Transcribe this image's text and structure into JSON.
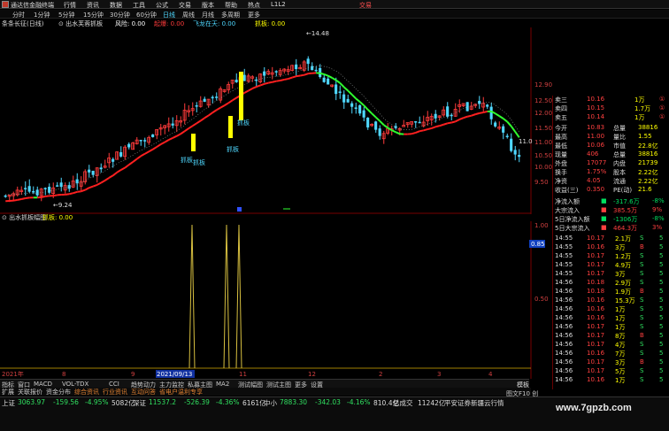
{
  "app": {
    "title": "通达信金融终端",
    "trade": "交易"
  },
  "menu": [
    "行情",
    "资讯",
    "数据",
    "工具",
    "公式",
    "交易",
    "版本",
    "帮助",
    "热点",
    "L1L2"
  ],
  "periods": [
    {
      "label": "分时",
      "active": false
    },
    {
      "label": "1分钟",
      "active": false
    },
    {
      "label": "5分钟",
      "active": false
    },
    {
      "label": "15分钟",
      "active": false
    },
    {
      "label": "30分钟",
      "active": false
    },
    {
      "label": "60分钟",
      "active": false
    },
    {
      "label": "日线",
      "active": true
    },
    {
      "label": "周线",
      "active": false
    },
    {
      "label": "月线",
      "active": false
    },
    {
      "label": "多周期",
      "active": false
    },
    {
      "label": "更多",
      "active": false
    }
  ],
  "main_indicator": {
    "name": "条条长征(日线)",
    "formula": "出水芙蓉抓板",
    "items": [
      {
        "label": "风险:",
        "value": "0.00",
        "color": "#ffffff"
      },
      {
        "label": "起爆:",
        "value": "0.00",
        "color": "#ff3b3b"
      },
      {
        "label": "飞龙在天:",
        "value": "0.00",
        "color": "#4fd8ff"
      },
      {
        "label": "抓板:",
        "value": "0.00",
        "color": "#ffff00"
      }
    ]
  },
  "sub_indicator": {
    "name": "出水抓板幅图",
    "label": "抓板:",
    "value": "0.00"
  },
  "chart_annotations": {
    "high": "14.48",
    "low": "9.24",
    "signals": [
      "抓板",
      "抓板",
      "抓板",
      "抓板"
    ],
    "date_box": "2021/09/13",
    "year_left": "2021年",
    "last_price_tag": "11.0"
  },
  "price_axis": [
    "12.90",
    "12.50",
    "12.00",
    "11.50",
    "11.00",
    "10.50",
    "10.00",
    "9.50"
  ],
  "sub_axis": [
    "1.00",
    "0.85",
    "0.50"
  ],
  "time_axis": [
    "2021年",
    "8",
    "9",
    "2021/09/13",
    "11",
    "12",
    "2",
    "3",
    "4"
  ],
  "quote": {
    "asks": [
      {
        "label": "卖三",
        "price": "10.16",
        "vol": "1万"
      },
      {
        "label": "卖四",
        "price": "10.15",
        "vol": "1.7万"
      },
      {
        "label": "卖五",
        "price": "10.14",
        "vol": "1万"
      }
    ],
    "stats": [
      {
        "l1": "今开",
        "v1": "10.83",
        "l2": "总量",
        "v2": "38816"
      },
      {
        "l1": "最高",
        "v1": "11.00",
        "l2": "量比",
        "v2": "1.55"
      },
      {
        "l1": "最低",
        "v1": "10.06",
        "l2": "市值",
        "v2": "22.8亿"
      },
      {
        "l1": "现量",
        "v1": "406",
        "l2": "总量",
        "v2": "38816"
      },
      {
        "l1": "外盘",
        "v1": "17077",
        "l2": "内盘",
        "v2": "21739"
      },
      {
        "l1": "换手",
        "v1": "1.75%",
        "l2": "股本",
        "v2": "2.22亿"
      },
      {
        "l1": "净资",
        "v1": "4.05",
        "l2": "流通",
        "v2": "2.22亿"
      },
      {
        "l1": "收益(三)",
        "v1": "0.350",
        "l2": "PE(动)",
        "v2": "21.6"
      }
    ],
    "flows": [
      {
        "label": "净流入额",
        "value": "-317.6万",
        "pct": "-8%",
        "color": "#00e060"
      },
      {
        "label": "大宗流入",
        "value": "385.5万",
        "pct": "9%",
        "color": "#ff4040"
      },
      {
        "label": "5日净流入额",
        "value": "-1306万",
        "pct": "-8%",
        "color": "#00e060"
      },
      {
        "label": "5日大宗流入",
        "value": "464.3万",
        "pct": "3%",
        "color": "#ff4040"
      }
    ],
    "ticks": [
      {
        "t": "14:55",
        "p": "10.17",
        "v": "2.1万",
        "d": "S"
      },
      {
        "t": "14:55",
        "p": "10.16",
        "v": "3万",
        "d": "B"
      },
      {
        "t": "14:55",
        "p": "10.17",
        "v": "1.2万",
        "d": "S"
      },
      {
        "t": "14:55",
        "p": "10.17",
        "v": "4.9万",
        "d": "S"
      },
      {
        "t": "14:55",
        "p": "10.17",
        "v": "3万",
        "d": "S"
      },
      {
        "t": "14:56",
        "p": "10.18",
        "v": "2.9万",
        "d": "S"
      },
      {
        "t": "14:56",
        "p": "10.18",
        "v": "1.9万",
        "d": "B"
      },
      {
        "t": "14:56",
        "p": "10.16",
        "v": "15.3万",
        "d": "S"
      },
      {
        "t": "14:56",
        "p": "10.16",
        "v": "1万",
        "d": "S"
      },
      {
        "t": "14:56",
        "p": "10.16",
        "v": "1万",
        "d": "S"
      },
      {
        "t": "14:56",
        "p": "10.17",
        "v": "1万",
        "d": "S"
      },
      {
        "t": "14:56",
        "p": "10.17",
        "v": "8万",
        "d": "B"
      },
      {
        "t": "14:56",
        "p": "10.17",
        "v": "4万",
        "d": "S"
      },
      {
        "t": "14:56",
        "p": "10.16",
        "v": "7万",
        "d": "S"
      },
      {
        "t": "14:56",
        "p": "10.17",
        "v": "3万",
        "d": "B"
      },
      {
        "t": "14:56",
        "p": "10.17",
        "v": "5万",
        "d": "S"
      },
      {
        "t": "14:56",
        "p": "10.16",
        "v": "1万",
        "d": "S"
      }
    ]
  },
  "tabs": [
    "指标",
    "窗口",
    "MACD",
    "VOL-TDX",
    "CCI",
    "趋势动力",
    "主力监控",
    "私募主图",
    "MA2",
    "测试幅图",
    "测试主图",
    "更多",
    "设置"
  ],
  "tabs2": [
    "扩展",
    "关联报价",
    "资金分布",
    "综合资讯",
    "行业资讯",
    "互动问答",
    "省电户温利专享"
  ],
  "tabs_right": "模板",
  "status": [
    {
      "name": "上证",
      "val": "3063.97",
      "chg": "-159.56",
      "pct": "-4.95%",
      "amt": "5082亿"
    },
    {
      "name": "深证",
      "val": "11537.2",
      "chg": "-526.39",
      "pct": "-4.36%",
      "amt": "6161亿"
    },
    {
      "name": "中小",
      "val": "7883.30",
      "chg": "-342.03",
      "pct": "-4.16%",
      "amt": "810.4亿"
    }
  ],
  "status_extra": {
    "label": "总成交",
    "amt": "11242亿",
    "note": "平安证券新疆云行情"
  },
  "watermark": "www.7gpzb.com",
  "bottom_hint": "图文F10 创"
}
